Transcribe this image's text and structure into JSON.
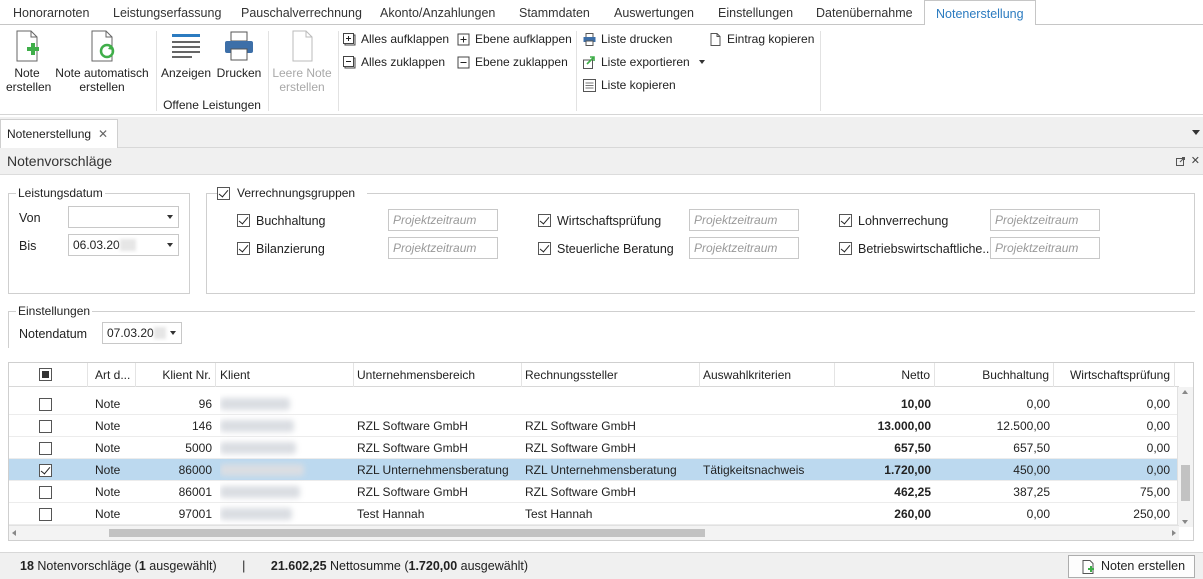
{
  "menu_tabs": [
    "Honorarnoten",
    "Leistungserfassung",
    "Pauschalverrechnung",
    "Akonto/Anzahlungen",
    "Stammdaten",
    "Auswertungen",
    "Einstellungen",
    "Datenübernahme",
    "Notenerstellung"
  ],
  "ribbon": {
    "note_erstellen": "Note\nerstellen",
    "note_auto": "Note automatisch\nerstellen",
    "anzeigen": "Anzeigen",
    "drucken": "Drucken",
    "group_offene": "Offene Leistungen",
    "leere_note": "Leere Note\nerstellen",
    "alles_aufklappen": "Alles aufklappen",
    "alles_zuklappen": "Alles zuklappen",
    "ebene_aufklappen": "Ebene aufklappen",
    "ebene_zuklappen": "Ebene zuklappen",
    "liste_drucken": "Liste drucken",
    "liste_exportieren": "Liste exportieren",
    "liste_kopieren": "Liste kopieren",
    "eintrag_kopieren": "Eintrag kopieren"
  },
  "doc_tab": "Notenerstellung",
  "panel_title": "Notenvorschläge",
  "leistungsdatum": {
    "legend": "Leistungsdatum",
    "von_label": "Von",
    "von_value": "",
    "bis_label": "Bis",
    "bis_value": "06.03.20"
  },
  "verrechnungsgruppen": {
    "legend": "Verrechnungsgruppen",
    "placeholder": "Projektzeitraum",
    "items": [
      "Buchhaltung",
      "Bilanzierung",
      "Wirtschaftsprüfung",
      "Steuerliche Beratung",
      "Lohnverrechung",
      "Betriebswirtschaftliche..."
    ]
  },
  "einstellungen": {
    "legend": "Einstellungen",
    "notendatum_label": "Notendatum",
    "notendatum_value": "07.03.20"
  },
  "table": {
    "columns": [
      "Art d...",
      "Klient Nr.",
      "Klient",
      "Unternehmensbereich",
      "Rechnungssteller",
      "Auswahlkriterien",
      "Netto",
      "Buchhaltung",
      "Wirtschaftsprüfung"
    ],
    "rows": [
      {
        "art": "Note",
        "nr": "96",
        "ub": "",
        "rs": "",
        "ak": "",
        "netto": "10,00",
        "bh": "0,00",
        "wp": "0,00",
        "checked": false
      },
      {
        "art": "Note",
        "nr": "146",
        "ub": "RZL Software GmbH",
        "rs": "RZL Software GmbH",
        "ak": "",
        "netto": "13.000,00",
        "bh": "12.500,00",
        "wp": "0,00",
        "checked": false
      },
      {
        "art": "Note",
        "nr": "5000",
        "ub": "RZL Software GmbH",
        "rs": "RZL Software GmbH",
        "ak": "",
        "netto": "657,50",
        "bh": "657,50",
        "wp": "0,00",
        "checked": false
      },
      {
        "art": "Note",
        "nr": "86000",
        "ub": "RZL Unternehmensberatung",
        "rs": "RZL Unternehmensberatung",
        "ak": "Tätigkeitsnachweis",
        "netto": "1.720,00",
        "bh": "450,00",
        "wp": "0,00",
        "checked": true
      },
      {
        "art": "Note",
        "nr": "86001",
        "ub": "RZL Software GmbH",
        "rs": "RZL Software GmbH",
        "ak": "",
        "netto": "462,25",
        "bh": "387,25",
        "wp": "75,00",
        "checked": false
      },
      {
        "art": "Note",
        "nr": "97001",
        "ub": "Test Hannah",
        "rs": "Test Hannah",
        "ak": "",
        "netto": "260,00",
        "bh": "0,00",
        "wp": "250,00",
        "checked": false
      }
    ]
  },
  "status": {
    "count": "18",
    "count_label": "Notenvorschläge (",
    "selected": "1",
    "selected_label": "ausgewählt)",
    "divider": "|",
    "sum": "21.602,25",
    "sum_label": "Nettosumme (",
    "sum_selected": "1.720,00",
    "sum_selected_label": "ausgewählt)"
  },
  "noten_erstellen_button": "Noten erstellen"
}
